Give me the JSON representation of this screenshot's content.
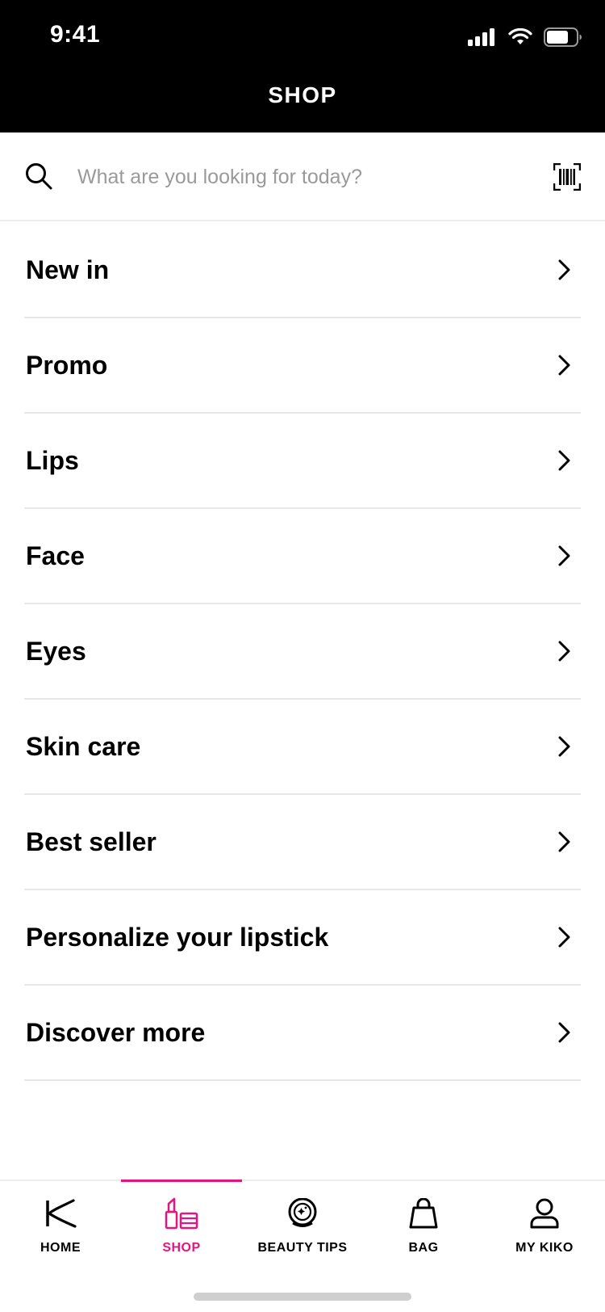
{
  "status_bar": {
    "time": "9:41"
  },
  "header": {
    "title": "SHOP"
  },
  "search": {
    "placeholder": "What are you looking for today?",
    "value": ""
  },
  "menu": {
    "items": [
      {
        "label": "New in"
      },
      {
        "label": "Promo"
      },
      {
        "label": "Lips"
      },
      {
        "label": "Face"
      },
      {
        "label": "Eyes"
      },
      {
        "label": "Skin care"
      },
      {
        "label": "Best seller"
      },
      {
        "label": "Personalize your lipstick"
      },
      {
        "label": "Discover more"
      }
    ]
  },
  "tabbar": {
    "active": "SHOP",
    "accent_color": "#e6157e",
    "tabs": [
      {
        "label": "HOME",
        "icon": "kiko-logo-icon"
      },
      {
        "label": "SHOP",
        "icon": "lipstick-icon"
      },
      {
        "label": "BEAUTY TIPS",
        "icon": "compact-mirror-icon"
      },
      {
        "label": "BAG",
        "icon": "shopping-bag-icon"
      },
      {
        "label": "MY KIKO",
        "icon": "user-icon"
      }
    ]
  }
}
